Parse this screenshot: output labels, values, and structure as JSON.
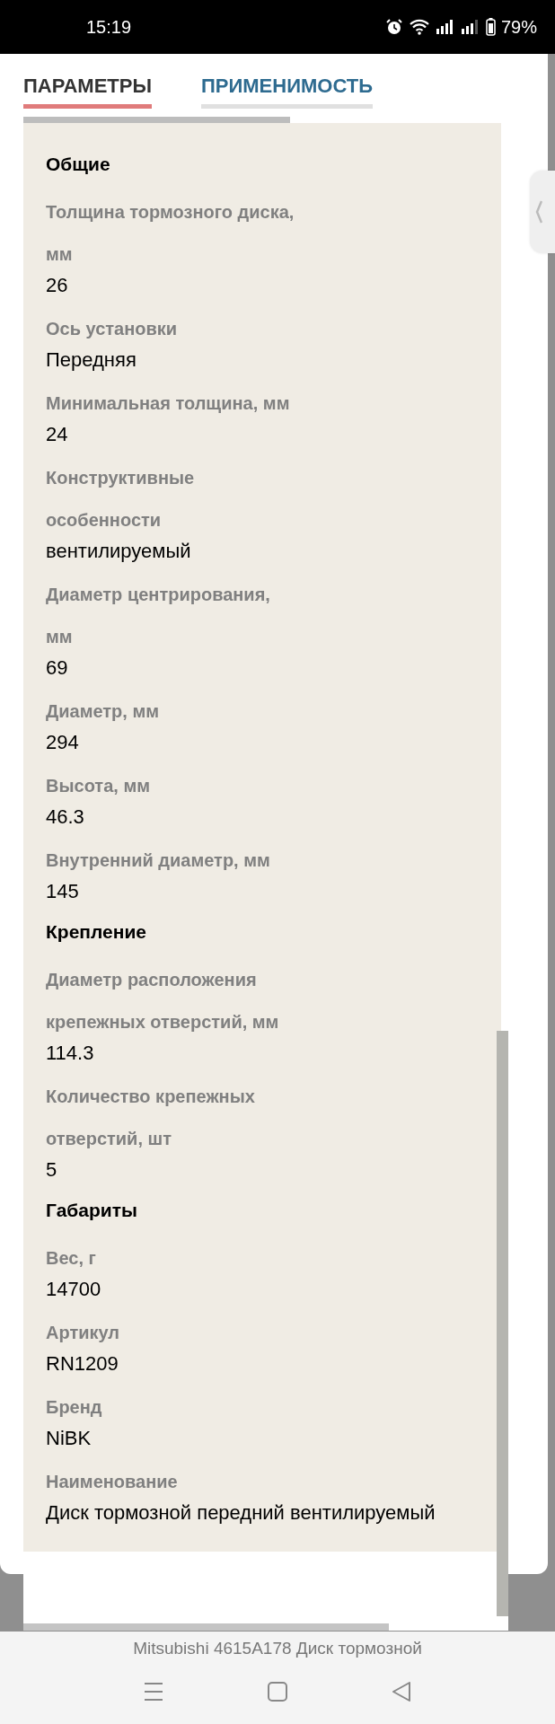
{
  "status_bar": {
    "time": "15:19",
    "battery": "79%"
  },
  "tabs": [
    {
      "label": "ПАРАМЕТРЫ",
      "selected": true
    },
    {
      "label": "ПРИМЕНИМОСТЬ",
      "selected": false
    }
  ],
  "sections": [
    {
      "title": "Общие",
      "rows": [
        {
          "label": [
            "Толщина тормозного диска,",
            "мм"
          ],
          "value": "26"
        },
        {
          "label": [
            "Ось установки"
          ],
          "value": "Передняя"
        },
        {
          "label": [
            "Минимальная толщина, мм"
          ],
          "value": "24"
        },
        {
          "label": [
            "Конструктивные",
            "особенности"
          ],
          "value": "вентилируемый"
        },
        {
          "label": [
            "Диаметр центрирования,",
            "мм"
          ],
          "value": "69"
        },
        {
          "label": [
            "Диаметр, мм"
          ],
          "value": "294"
        },
        {
          "label": [
            "Высота, мм"
          ],
          "value": "46.3"
        },
        {
          "label": [
            "Внутренний диаметр, мм"
          ],
          "value": "145"
        }
      ]
    },
    {
      "title": "Крепление",
      "rows": [
        {
          "label": [
            "Диаметр расположения",
            "крепежных отверстий, мм"
          ],
          "value": "114.3"
        },
        {
          "label": [
            "Количество крепежных",
            "отверстий, шт"
          ],
          "value": "5"
        }
      ]
    },
    {
      "title": "Габариты",
      "rows": [
        {
          "label": [
            "Вес, г"
          ],
          "value": "14700"
        },
        {
          "label": [
            "Артикул"
          ],
          "value": "RN1209"
        },
        {
          "label": [
            "Бренд"
          ],
          "value": "NiBK"
        },
        {
          "label": [
            "Наименование"
          ],
          "value": "Диск тормозной передний вентилируемый"
        }
      ]
    }
  ],
  "footer": {
    "caption": "Mitsubishi 4615A178 Диск тормозной"
  }
}
